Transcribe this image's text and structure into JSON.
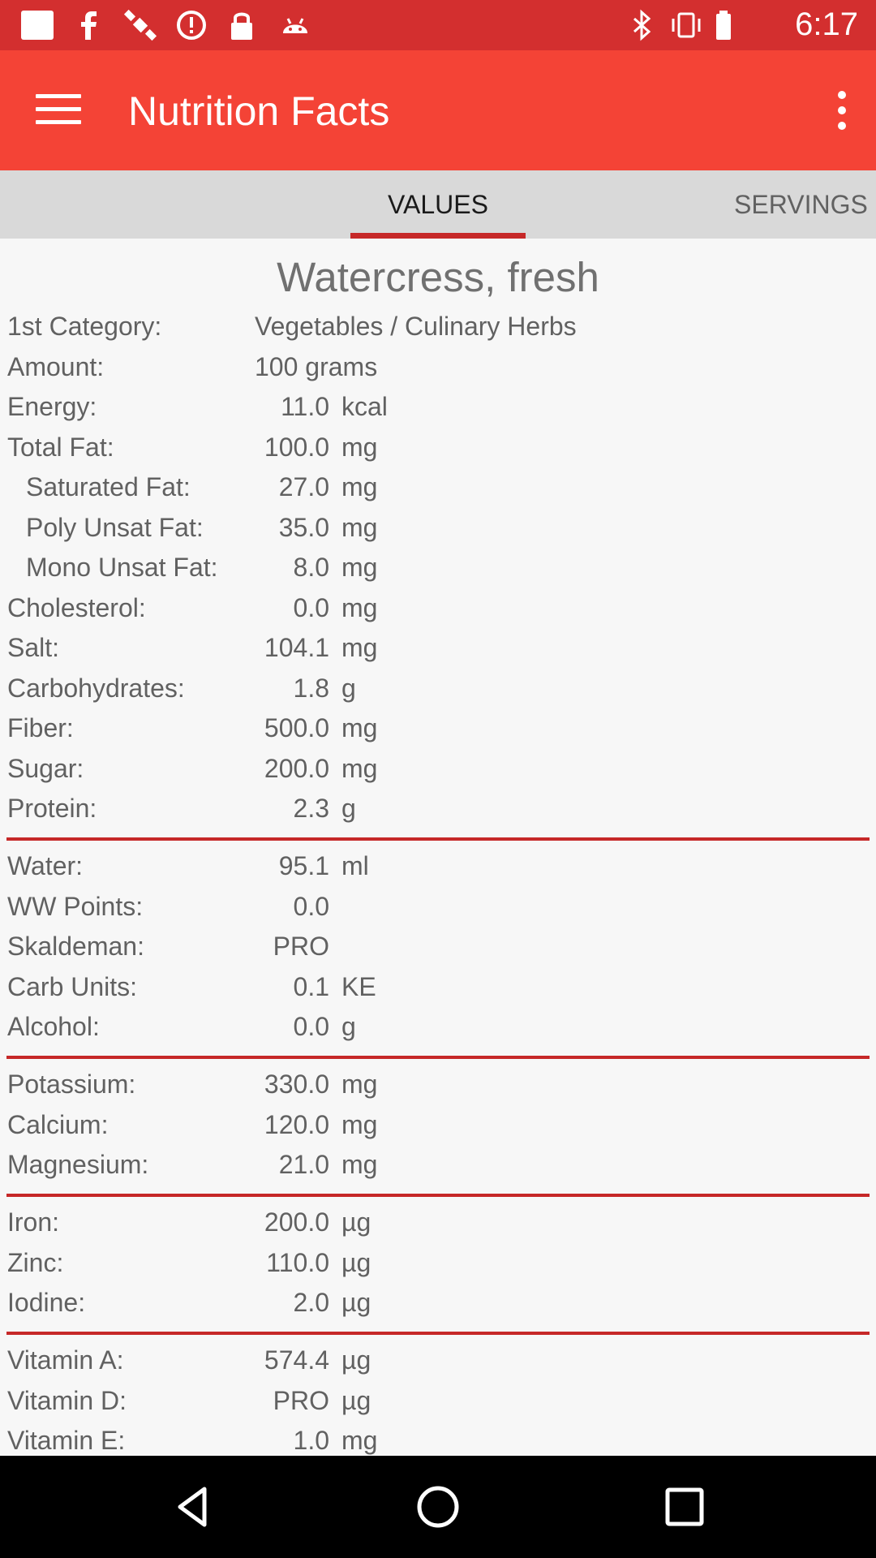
{
  "status_bar": {
    "time": "6:17",
    "icons_left": [
      "notification-square-icon",
      "facebook-icon",
      "satellite-icon",
      "alert-icon",
      "lock-icon",
      "android-icon"
    ],
    "icons_right": [
      "bluetooth-icon",
      "vibrate-icon",
      "battery-icon"
    ]
  },
  "app_bar": {
    "title": "Nutrition Facts",
    "color": "#f44336"
  },
  "tabs": [
    {
      "label": "VALUES",
      "selected": true
    },
    {
      "label": "SERVINGS",
      "selected": false
    }
  ],
  "food": {
    "name": "Watercress, fresh",
    "category_label": "1st Category:",
    "category_value": "Vegetables / Culinary Herbs",
    "amount_label": "Amount:",
    "amount_value": "100 grams"
  },
  "nutrients": [
    {
      "label": "Energy:",
      "value": "11.0",
      "unit": "kcal"
    },
    {
      "label": "Total Fat:",
      "value": "100.0",
      "unit": "mg"
    },
    {
      "label": "Saturated Fat:",
      "value": "27.0",
      "unit": "mg"
    },
    {
      "label": "Poly Unsat Fat:",
      "value": "35.0",
      "unit": "mg"
    },
    {
      "label": "Mono Unsat Fat:",
      "value": "8.0",
      "unit": "mg"
    },
    {
      "label": "Cholesterol:",
      "value": "0.0",
      "unit": "mg"
    },
    {
      "label": "Salt:",
      "value": "104.1",
      "unit": "mg"
    },
    {
      "label": "Carbohydrates:",
      "value": "1.8",
      "unit": "g"
    },
    {
      "label": "Fiber:",
      "value": "500.0",
      "unit": "mg"
    },
    {
      "label": "Sugar:",
      "value": "200.0",
      "unit": "mg"
    },
    {
      "label": "Protein:",
      "value": "2.3",
      "unit": "g"
    },
    {
      "label": "Water:",
      "value": "95.1",
      "unit": "ml"
    },
    {
      "label": "WW Points:",
      "value": "0.0",
      "unit": ""
    },
    {
      "label": "Skaldeman:",
      "value": "PRO",
      "unit": ""
    },
    {
      "label": "Carb Units:",
      "value": "0.1",
      "unit": "KE"
    },
    {
      "label": "Alcohol:",
      "value": "0.0",
      "unit": "g"
    },
    {
      "label": "Potassium:",
      "value": "330.0",
      "unit": "mg"
    },
    {
      "label": "Calcium:",
      "value": "120.0",
      "unit": "mg"
    },
    {
      "label": "Magnesium:",
      "value": "21.0",
      "unit": "mg"
    },
    {
      "label": "Iron:",
      "value": "200.0",
      "unit": "µg"
    },
    {
      "label": "Zinc:",
      "value": "110.0",
      "unit": "µg"
    },
    {
      "label": "Iodine:",
      "value": "2.0",
      "unit": "µg"
    },
    {
      "label": "Vitamin A:",
      "value": "574.4",
      "unit": "µg"
    },
    {
      "label": "Vitamin D:",
      "value": "PRO",
      "unit": "µg"
    },
    {
      "label": "Vitamin E:",
      "value": "1.0",
      "unit": "mg"
    }
  ],
  "nav_bar": {
    "buttons": [
      "back-icon",
      "home-icon",
      "recents-icon"
    ]
  }
}
